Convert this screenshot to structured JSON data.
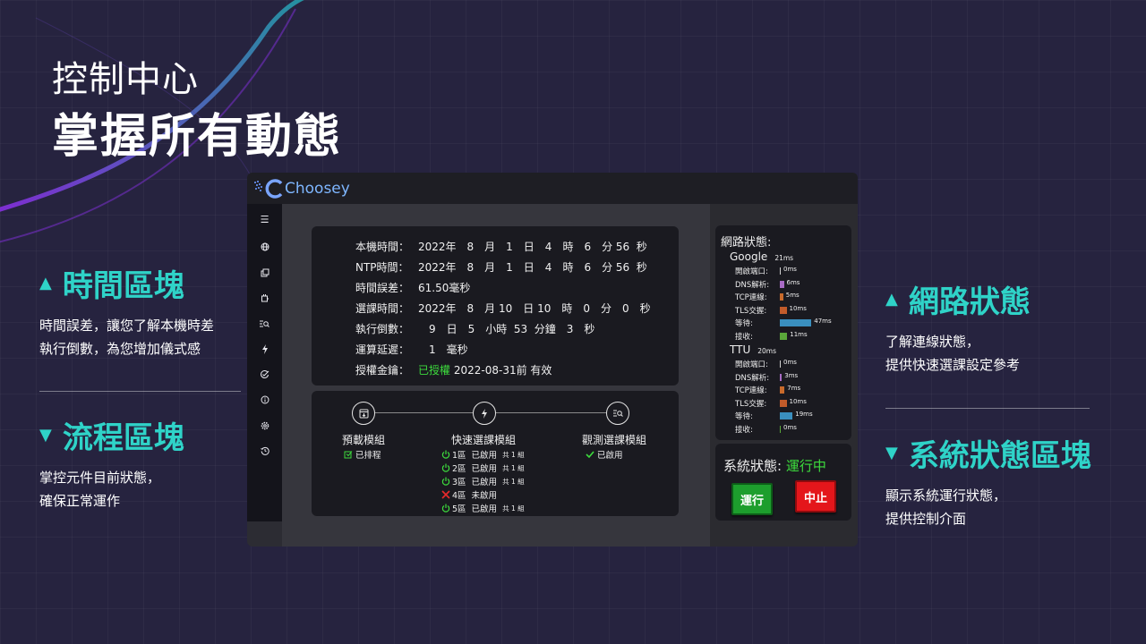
{
  "hero": {
    "subtitle": "控制中心",
    "title": "掌握所有動態"
  },
  "features": {
    "time": {
      "title": "時間區塊",
      "desc": "時間誤差，讓您了解本機時差\n執行倒數，為您增加儀式感"
    },
    "flow": {
      "title": "流程區塊",
      "desc": "掌控元件目前狀態，\n確保正常運作"
    },
    "network": {
      "title": "網路狀態",
      "desc": "了解連線狀態，\n提供快速選課設定參考"
    },
    "system": {
      "title": "系統狀態區塊",
      "desc": "顯示系統運行狀態，\n提供控制介面"
    }
  },
  "app": {
    "brand": "Choosey",
    "sidebar_icons": [
      "menu-icon",
      "globe-icon",
      "copy-icon",
      "plugin-icon",
      "search-list-icon",
      "bolt-icon",
      "check-circle-icon",
      "info-icon",
      "settings-icon",
      "history-icon"
    ],
    "time_block": {
      "local_time": {
        "label": "本機時間：",
        "value": "2022年　8　月　1　日　4　時　6　分 56  秒"
      },
      "ntp_time": {
        "label": "NTP時間：",
        "value": "2022年　8　月　1　日　4　時　6　分 56  秒"
      },
      "time_diff": {
        "label": "時間誤差：",
        "value": "61.50毫秒"
      },
      "course_time": {
        "label": "選課時間：",
        "value": "2022年　8　月 10　日 10　時　0　分　0　秒"
      },
      "countdown": {
        "label": "執行倒數：",
        "value": "　9　日　5　小時  53  分鐘　3　秒"
      },
      "calc_delay": {
        "label": "運算延遲：",
        "value": "　1　毫秒"
      },
      "license": {
        "label": "授權金鑰：",
        "status": "已授權",
        "expiry": "2022-08-31前 有效"
      }
    },
    "flow_block": {
      "modules": [
        {
          "title": "預載模組",
          "status": "已排程"
        },
        {
          "title": "快速選課模組"
        },
        {
          "title": "觀測選課模組",
          "status": "已啟用"
        }
      ],
      "zones": [
        {
          "name": "1區",
          "status": "已啟用",
          "count": "共 1 組"
        },
        {
          "name": "2區",
          "status": "已啟用",
          "count": "共 1 組"
        },
        {
          "name": "3區",
          "status": "已啟用",
          "count": "共 1 組"
        },
        {
          "name": "4區",
          "status": "未啟用",
          "count": ""
        },
        {
          "name": "5區",
          "status": "已啟用",
          "count": "共 1 組"
        }
      ]
    },
    "network_block": {
      "title": "網路狀態:",
      "hosts": [
        {
          "name": "Google",
          "total": "21ms",
          "rows": [
            {
              "label": "開啟端口:",
              "value": "0ms",
              "ms": 0,
              "color": "#cfcfcf"
            },
            {
              "label": "DNS解析:",
              "value": "6ms",
              "ms": 6,
              "color": "#a86bc4"
            },
            {
              "label": "TCP連線:",
              "value": "5ms",
              "ms": 5,
              "color": "#c86a2b"
            },
            {
              "label": "TLS交握:",
              "value": "10ms",
              "ms": 10,
              "color": "#c25b2a"
            },
            {
              "label": "等待:",
              "value": "47ms",
              "ms": 47,
              "color": "#3a8fbf"
            },
            {
              "label": "接收:",
              "value": "11ms",
              "ms": 11,
              "color": "#5aa83a"
            }
          ]
        },
        {
          "name": "TTU",
          "total": "20ms",
          "rows": [
            {
              "label": "開啟端口:",
              "value": "0ms",
              "ms": 0,
              "color": "#cfcfcf"
            },
            {
              "label": "DNS解析:",
              "value": "3ms",
              "ms": 3,
              "color": "#a86bc4"
            },
            {
              "label": "TCP連線:",
              "value": "7ms",
              "ms": 7,
              "color": "#c86a2b"
            },
            {
              "label": "TLS交握:",
              "value": "10ms",
              "ms": 10,
              "color": "#c25b2a"
            },
            {
              "label": "等待:",
              "value": "19ms",
              "ms": 19,
              "color": "#3a8fbf"
            },
            {
              "label": "接收:",
              "value": "0ms",
              "ms": 0,
              "color": "#5aa83a"
            }
          ]
        }
      ]
    },
    "system_block": {
      "label": "系統狀態:",
      "status": "運行中",
      "run_button": "運行",
      "stop_button": "中止"
    }
  }
}
